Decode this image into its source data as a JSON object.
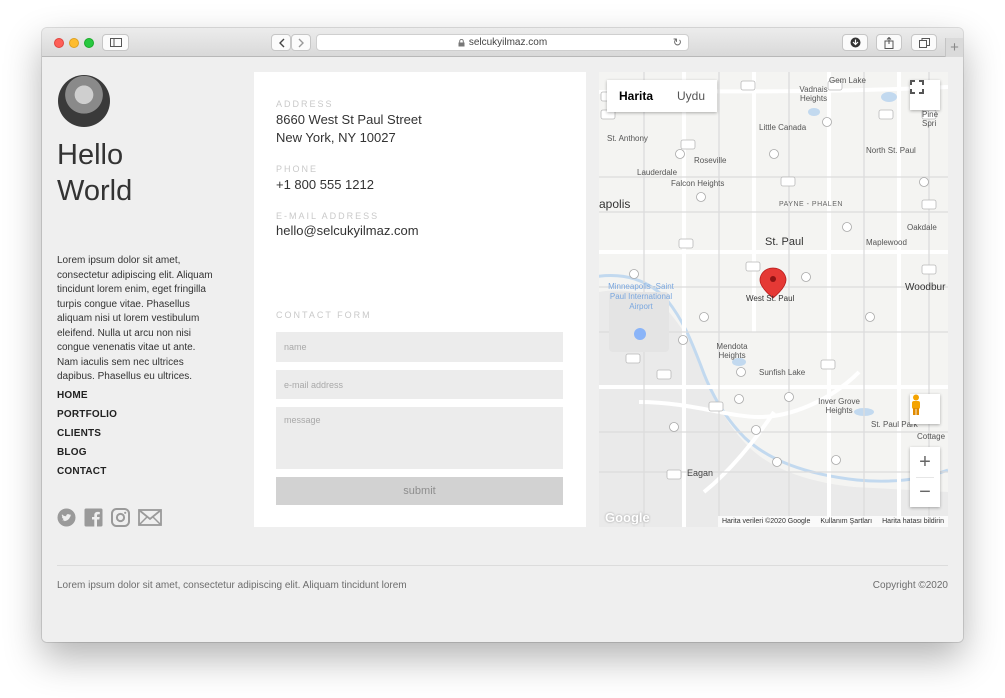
{
  "browser": {
    "url": "selcukyilmaz.com",
    "new_tab": "+"
  },
  "profile": {
    "greeting_line1": "Hello",
    "greeting_line2": "World",
    "bio": "Lorem ipsum dolor sit amet, consectetur adipiscing elit. Aliquam tincidunt lorem enim, eget fringilla turpis congue vitae. Phasellus aliquam nisi ut lorem vestibulum eleifend. Nulla ut arcu non nisi congue venenatis vitae ut ante. Nam iaculis sem nec ultrices dapibus. Phasellus eu ultrices."
  },
  "nav": [
    {
      "label": "HOME"
    },
    {
      "label": "PORTFOLIO"
    },
    {
      "label": "CLIENTS"
    },
    {
      "label": "BLOG"
    },
    {
      "label": "CONTACT"
    }
  ],
  "social_icons": [
    "twitter-icon",
    "facebook-icon",
    "instagram-icon",
    "mail-icon"
  ],
  "contact": {
    "address_label": "ADDRESS",
    "address_line1": "8660 West St Paul Street",
    "address_line2": "New York, NY 10027",
    "phone_label": "PHONE",
    "phone": "+1 800 555 1212",
    "email_label": "E-MAIL ADDRESS",
    "email": "hello@selcukyilmaz.com"
  },
  "form": {
    "title": "CONTACT FORM",
    "name_placeholder": "name",
    "email_placeholder": "e-mail address",
    "message_placeholder": "message",
    "submit_label": "submit"
  },
  "map": {
    "tab_map": "Harita",
    "tab_satellite": "Uydu",
    "pin_label": "West St. Paul",
    "zoom_in": "+",
    "zoom_out": "−",
    "google_logo": "Google",
    "attribution_data": "Harita verileri ©2020 Google",
    "attribution_terms": "Kullanım Şartları",
    "attribution_report": "Harita hatası bildirin",
    "places": [
      "Gem Lake",
      "Vadnais Heights",
      "Little Canada",
      "Pine Spri",
      "St. Anthony",
      "Roseville",
      "North St. Paul",
      "Lauderdale",
      "Falcon Heights",
      "apolis",
      "PAYNE - PHALEN",
      "St. Paul",
      "Oakdale",
      "Maplewood",
      "Woodbur",
      "Minneapolis -Saint Paul International Airport",
      "Mendota Heights",
      "Sunfish Lake",
      "Inver Grove Heights",
      "St. Paul Park",
      "Cottage",
      "Eagan"
    ],
    "colors": {
      "water": "#a8c7e8",
      "road": "#ffffff",
      "highway_shield": "#ffffff",
      "pin": "#e53935",
      "land": "#f4f4f2"
    }
  },
  "footer": {
    "text": "Lorem ipsum dolor sit amet, consectetur adipiscing elit. Aliquam tincidunt lorem",
    "copyright": "Copyright ©2020"
  }
}
